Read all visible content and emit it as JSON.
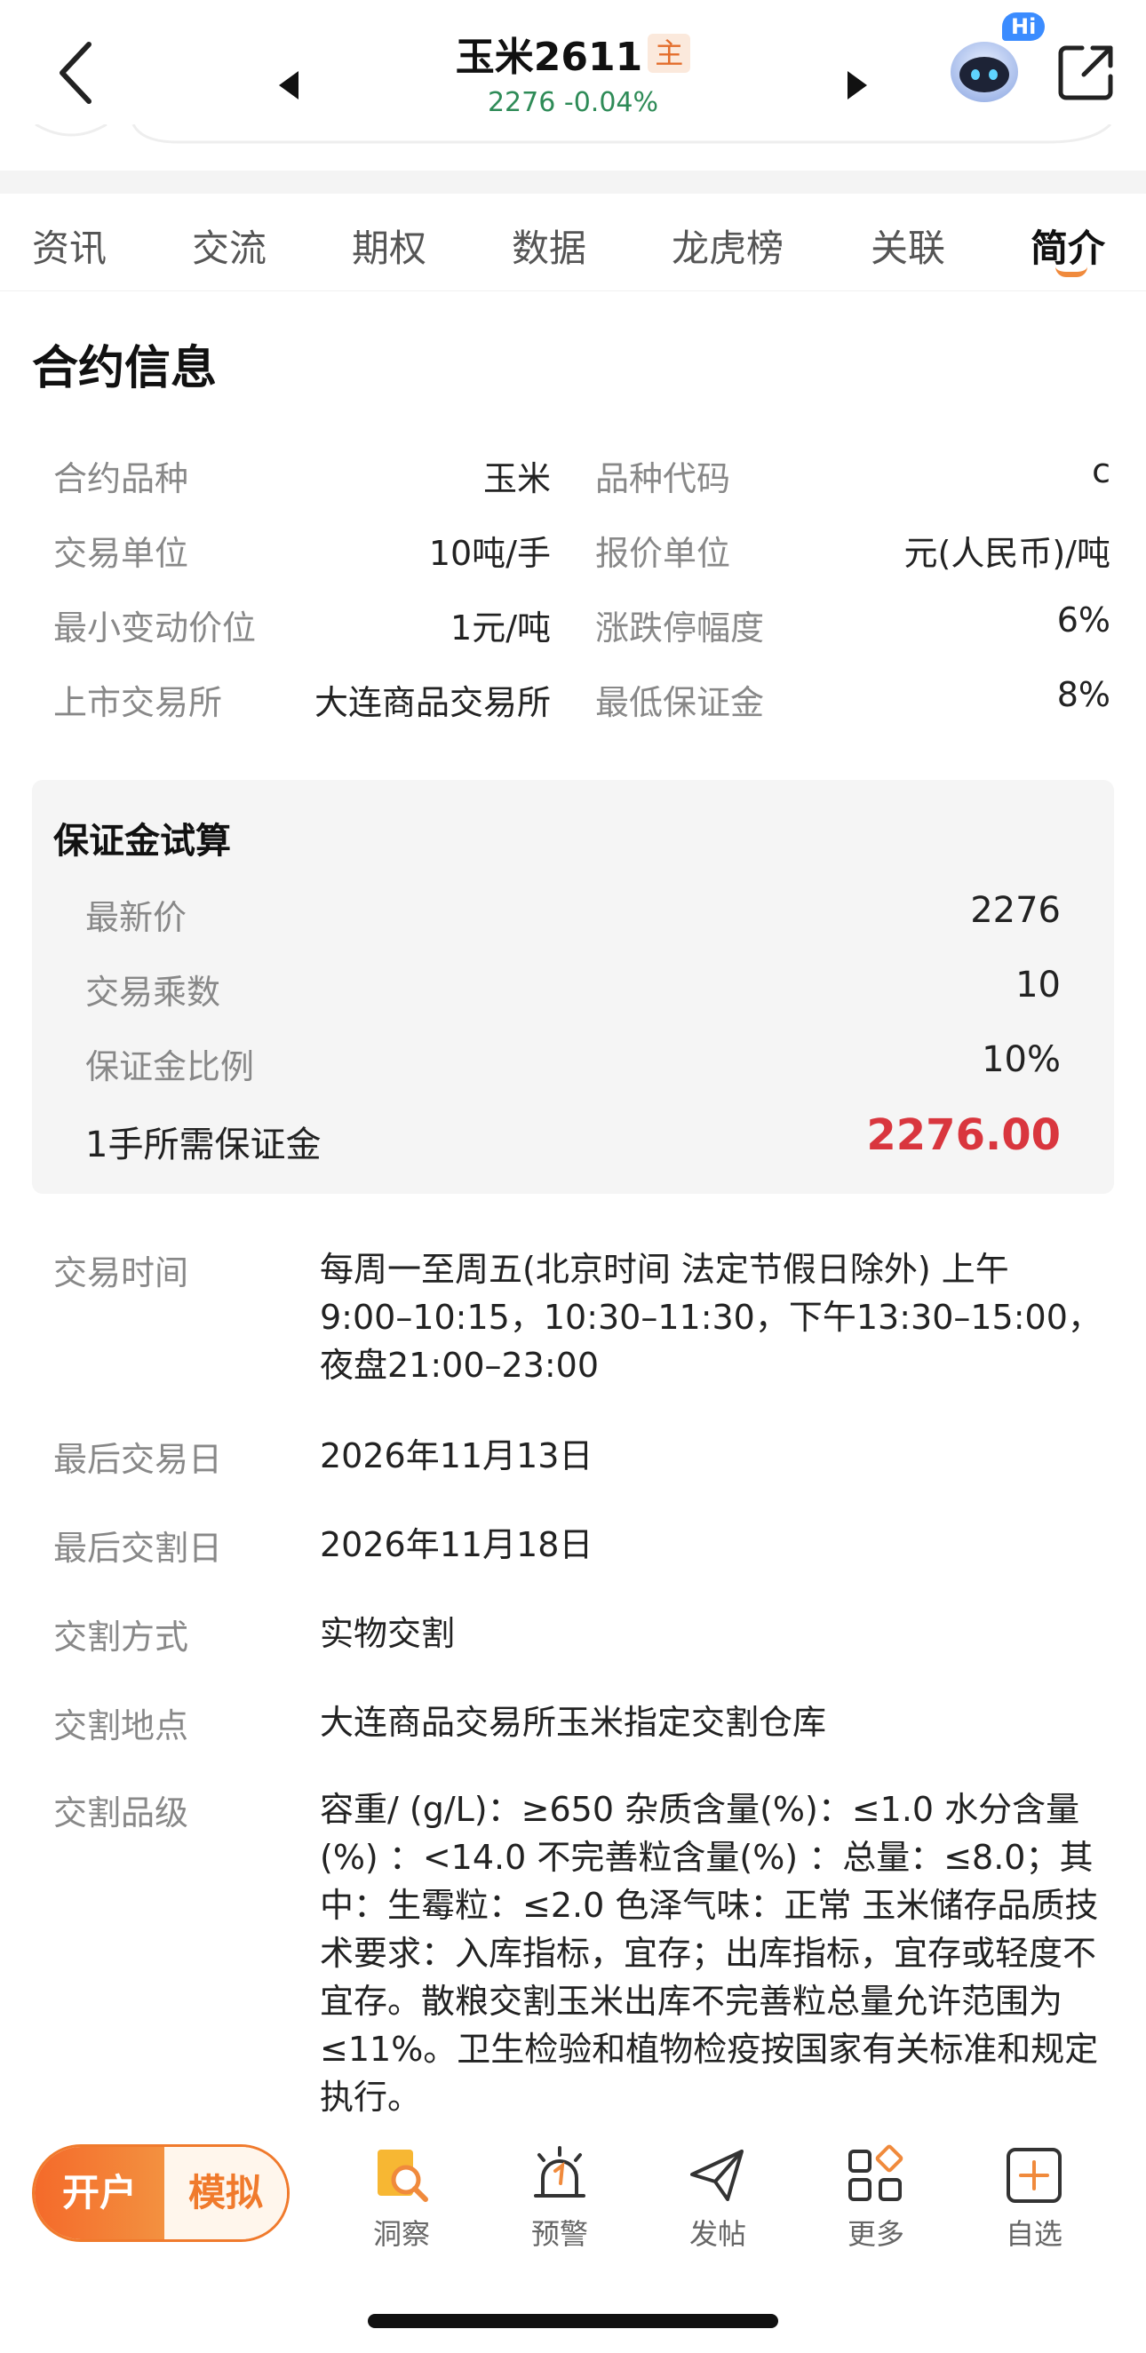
{
  "header": {
    "title": "玉米2611",
    "badge": "主",
    "price": "2276",
    "change": "-0.04%",
    "hi_badge": "Hi"
  },
  "tabs": [
    {
      "label": "资讯"
    },
    {
      "label": "交流"
    },
    {
      "label": "期权"
    },
    {
      "label": "数据"
    },
    {
      "label": "龙虎榜"
    },
    {
      "label": "关联"
    },
    {
      "label": "简介",
      "active": true
    }
  ],
  "contract": {
    "section_title": "合约信息",
    "rows": [
      {
        "l1": "合约品种",
        "v1": "玉米",
        "l2": "品种代码",
        "v2": "c"
      },
      {
        "l1": "交易单位",
        "v1": "10吨/手",
        "l2": "报价单位",
        "v2": "元(人民币)/吨"
      },
      {
        "l1": "最小变动价位",
        "v1": "1元/吨",
        "l2": "涨跌停幅度",
        "v2": "6%"
      },
      {
        "l1": "上市交易所",
        "v1": "大连商品交易所",
        "l2": "最低保证金",
        "v2": "8%"
      }
    ]
  },
  "margin_calc": {
    "title": "保证金试算",
    "rows": [
      {
        "label": "最新价",
        "value": "2276"
      },
      {
        "label": "交易乘数",
        "value": "10"
      },
      {
        "label": "保证金比例",
        "value": "10%"
      }
    ],
    "total_label": "1手所需保证金",
    "total_value": "2276.00"
  },
  "details": [
    {
      "label": "交易时间",
      "value": "每周一至周五(北京时间 法定节假日除外) 上午9:00–10:15，10:30–11:30，下午13:30–15:00，夜盘21:00–23:00"
    },
    {
      "label": "最后交易日",
      "value": "2026年11月13日"
    },
    {
      "label": "最后交割日",
      "value": "2026年11月18日"
    },
    {
      "label": "交割方式",
      "value": "实物交割"
    },
    {
      "label": "交割地点",
      "value": "大连商品交易所玉米指定交割仓库"
    },
    {
      "label": "交割品级",
      "value": "容重/ (g/L)：≥650  杂质含量(%)：≤1.0  水分含量(%) ：<14.0  不完善粒含量(%) ：总量：≤8.0；其中：生霉粒：≤2.0  色泽气味：正常 玉米储存品质技术要求：入库指标，宜存；出库指标，宜存或轻度不宜存。散粮交割玉米出库不完善粒总量允许范围为≤11%。卫生检验和植物检疫按国家有关标准和规定执行。"
    }
  ],
  "bottom_bar": {
    "open_label": "开户",
    "sim_label": "模拟",
    "items": [
      {
        "label": "洞察",
        "icon": "insight-icon"
      },
      {
        "label": "预警",
        "icon": "alarm-icon"
      },
      {
        "label": "发帖",
        "icon": "send-icon"
      },
      {
        "label": "更多",
        "icon": "grid-icon"
      },
      {
        "label": "自选",
        "icon": "add-watch-icon"
      }
    ]
  }
}
